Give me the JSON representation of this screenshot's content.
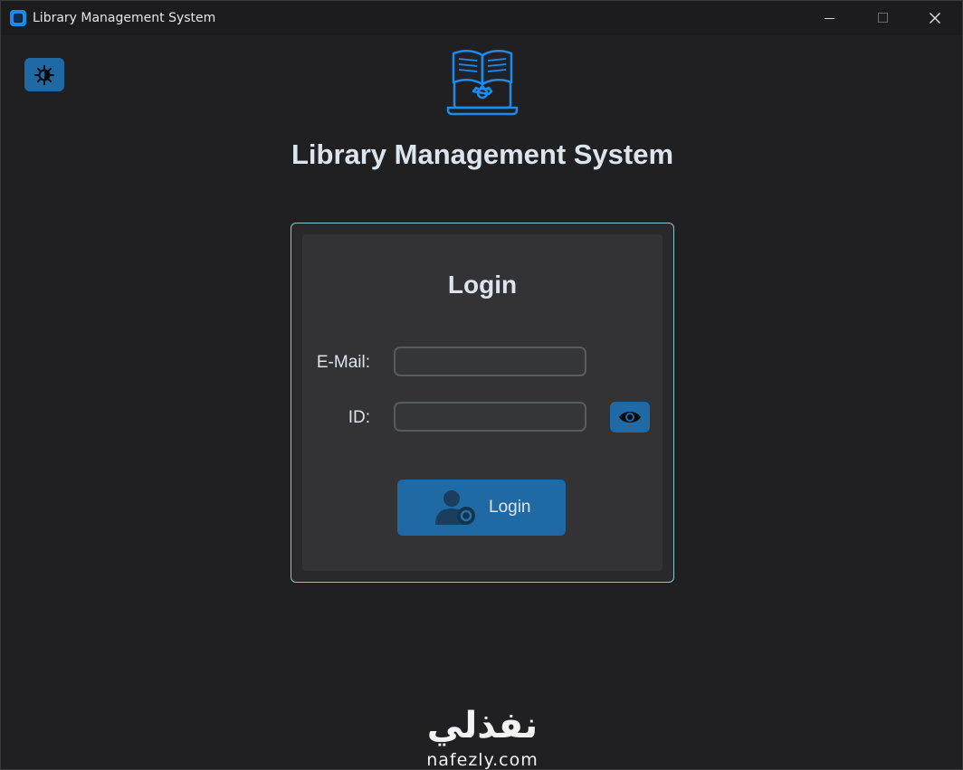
{
  "window": {
    "title": "Library Management System",
    "icon": "app-window-icon"
  },
  "theme_toggle": {
    "icon": "brightness-icon",
    "color": "#1f6aa5"
  },
  "header": {
    "logo": "book-gear-laptop-logo",
    "title": "Library Management System"
  },
  "login_card": {
    "title": "Login",
    "email_label": "E-Mail:",
    "email_value": "",
    "id_label": "ID:",
    "id_value": "",
    "show_password_icon": "eye-icon",
    "login_button_label": "Login",
    "login_button_icon": "user-settings-icon",
    "border_color": "#8fc4cf"
  },
  "watermark": {
    "arabic": "نفذلي",
    "latin": "nafezly.com"
  },
  "colors": {
    "accent": "#1f6aa5",
    "background": "#201f21",
    "card": "#333234",
    "text": "#dce4ee"
  }
}
